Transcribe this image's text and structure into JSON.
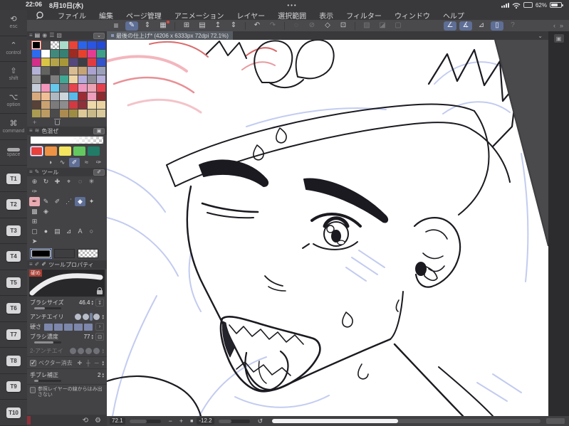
{
  "status": {
    "time": "22:06",
    "date": "8月10日(水)",
    "center": "•••",
    "battery_percent": "62%"
  },
  "edge_keyboard": {
    "keys": [
      {
        "id": "esc",
        "glyph": "⟲",
        "label": "esc"
      },
      {
        "id": "control",
        "glyph": "⌃",
        "label": "control"
      },
      {
        "id": "shift",
        "glyph": "⇧",
        "label": "shift"
      },
      {
        "id": "option",
        "glyph": "⌥",
        "label": "option"
      },
      {
        "id": "command",
        "glyph": "⌘",
        "label": "command"
      },
      {
        "id": "space",
        "glyph": "",
        "label": "space"
      },
      {
        "id": "t1",
        "type": "t",
        "label": "T1"
      },
      {
        "id": "t2",
        "type": "t",
        "label": "T2"
      },
      {
        "id": "t3",
        "type": "t",
        "label": "T3"
      },
      {
        "id": "t4",
        "type": "t",
        "label": "T4"
      },
      {
        "id": "t5",
        "type": "t",
        "label": "T5"
      },
      {
        "id": "t6",
        "type": "t",
        "label": "T6"
      },
      {
        "id": "t7",
        "type": "t",
        "label": "T7"
      },
      {
        "id": "t8",
        "type": "t",
        "label": "T8"
      },
      {
        "id": "t9",
        "type": "t",
        "label": "T9"
      },
      {
        "id": "t10",
        "type": "t",
        "label": "T10"
      }
    ]
  },
  "menubar": {
    "items": [
      "ファイル",
      "編集",
      "ページ管理",
      "アニメーション",
      "レイヤー",
      "選択範囲",
      "表示",
      "フィルター",
      "ウィンドウ",
      "ヘルプ"
    ]
  },
  "toolbar": {
    "hamburger": "≡",
    "buttons": [
      {
        "name": "edit-mode",
        "glyph": "✎",
        "state": "active"
      },
      {
        "name": "mode-expand",
        "glyph": "⇕"
      },
      {
        "name": "gallery",
        "glyph": "▦",
        "badge": true
      },
      {
        "divider": true
      },
      {
        "name": "new-canvas",
        "glyph": "⊞"
      },
      {
        "name": "open-file",
        "glyph": "▤"
      },
      {
        "name": "export",
        "glyph": "↥"
      },
      {
        "name": "export-expand",
        "glyph": "⇕"
      },
      {
        "divider": true
      },
      {
        "name": "undo",
        "glyph": "↶"
      },
      {
        "name": "redo",
        "glyph": "↷",
        "state": "dim"
      },
      {
        "divider": true
      },
      {
        "name": "select-area",
        "glyph": "◌",
        "state": "dim"
      },
      {
        "name": "deselect",
        "glyph": "⊘",
        "state": "dim"
      },
      {
        "name": "fill",
        "glyph": "◇"
      },
      {
        "name": "transform",
        "glyph": "⊡"
      },
      {
        "divider": true
      },
      {
        "name": "mask",
        "glyph": "▧",
        "state": "dim"
      },
      {
        "name": "layer-gradient",
        "glyph": "◪",
        "state": "dim"
      },
      {
        "name": "frame",
        "glyph": "▢",
        "state": "dim"
      }
    ],
    "right_buttons": [
      {
        "name": "snap-ruler",
        "glyph": "∠",
        "state": "active"
      },
      {
        "name": "snap-curve",
        "glyph": "∡",
        "state": "active"
      },
      {
        "name": "snap-grid",
        "glyph": "⊿"
      },
      {
        "name": "companion-mode",
        "glyph": "▯",
        "state": "active"
      },
      {
        "name": "help",
        "glyph": "?",
        "state": "dim"
      }
    ],
    "collapse_glyphs": [
      "‹",
      "»"
    ]
  },
  "canvas": {
    "tab_title": "最後の仕上げ* (4206 x 6333px 72dpi 72.1%)"
  },
  "panels": {
    "color": {
      "header_icons": [
        {
          "name": "panel-menu",
          "glyph": "≡"
        },
        {
          "name": "color-set-tab",
          "glyph": "▤",
          "active": true
        },
        {
          "name": "color-wheel-tab",
          "glyph": "◉"
        },
        {
          "name": "color-slider-tab",
          "glyph": "☰"
        },
        {
          "name": "approx-color-tab",
          "glyph": "▧"
        }
      ],
      "collapse_glyph": "⌄",
      "add_glyph": "+",
      "selected_index": 0,
      "swatches": [
        "#000000",
        "#4a4a4a",
        "checker",
        "#aadcca",
        "#e84338",
        "#2b63ea",
        "#2a55e2",
        "#2349d8",
        "#2c6bf0",
        "#ffffff",
        "#418a7b",
        "#368174",
        "#9e2a21",
        "#e8402b",
        "#e73b92",
        "#3da189",
        "#d22e8a",
        "#d9c445",
        "#b3a44a",
        "#a89838",
        "#55477c",
        "#3d3d45",
        "#e13b41",
        "#3153cd",
        "#b4b1d7",
        "#636360",
        "#404040",
        "#595959",
        "#dabc93",
        "#c7a475",
        "#aaa3d0",
        "#9ba1b9",
        "#9d9d9d",
        "#3b3b3b",
        "#7f7f7f",
        "#40a794",
        "#edd5a5",
        "#b3abdc",
        "#8c8c94",
        "#b5afd9",
        "#c6cdd9",
        "#f396bc",
        "#65c9ed",
        "#71757d",
        "#e9444e",
        "#ef95bd",
        "#eba3b3",
        "#e5414d",
        "#d7aa7d",
        "#efbe95",
        "#afb7c1",
        "#cdd5db",
        "#59bae9",
        "#9d2b35",
        "#ef9dbd",
        "#8d2931",
        "#574139",
        "#caa271",
        "#7b7b7b",
        "#8d8d8d",
        "#d33941",
        "#8f3139",
        "#edd9a9",
        "#ead3a1",
        "#a99b51",
        "#bc9b63",
        "#4b4b4b",
        "#ac8b51",
        "#9d8d43",
        "#ddc997",
        "#c9b989",
        "#d9c99b"
      ]
    },
    "mix": {
      "title": "色混ぜ",
      "header_icon": "≋",
      "chips": [
        "#e8403c",
        "#ee9243",
        "#f4e45e",
        "#63c85f",
        "#207b67"
      ],
      "selected_chip": 0,
      "tools": [
        {
          "name": "blend-tool",
          "glyph": "◑"
        },
        {
          "name": "smudge-tool",
          "glyph": "∿"
        },
        {
          "name": "mix-brush-tool",
          "glyph": "✐",
          "active": true
        },
        {
          "name": "watercolor-tool",
          "glyph": "≈"
        },
        {
          "name": "pick-tool",
          "glyph": "✑"
        }
      ]
    },
    "tool": {
      "title": "ツール",
      "rows": [
        [
          {
            "name": "zoom-tool",
            "glyph": "⊕"
          },
          {
            "name": "rotate-tool",
            "glyph": "↻"
          },
          {
            "name": "move-tool",
            "glyph": "✚"
          },
          {
            "name": "operate-tool",
            "glyph": "⌖"
          },
          {
            "name": "lasso-tool",
            "glyph": "◌"
          },
          {
            "name": "wand-tool",
            "glyph": "✳"
          }
        ],
        [
          {
            "name": "eyedropper-tool",
            "glyph": "✑"
          }
        ],
        [
          {
            "name": "pen-tool",
            "glyph": "✒",
            "accent": true
          },
          {
            "name": "pencil-tool",
            "glyph": "✎"
          },
          {
            "name": "brush-tool",
            "glyph": "✐"
          },
          {
            "name": "airbrush-tool",
            "glyph": "⋰"
          },
          {
            "name": "eraser-tool",
            "glyph": "◆",
            "active": true
          },
          {
            "name": "decoration-tool",
            "glyph": "✦"
          }
        ],
        [
          {
            "name": "gradient-tool",
            "glyph": "▩"
          },
          {
            "name": "fill-tool",
            "glyph": "◈"
          }
        ],
        [
          {
            "name": "frame-border-tool",
            "glyph": "⊞"
          }
        ],
        [
          {
            "name": "selection-tool",
            "glyph": "▢"
          },
          {
            "name": "figure-tool",
            "glyph": "●"
          },
          {
            "name": "panel-tool",
            "glyph": "▤"
          },
          {
            "name": "ruler-tool",
            "glyph": "⊿"
          },
          {
            "name": "text-tool",
            "glyph": "A"
          },
          {
            "name": "balloon-tool",
            "glyph": "○"
          }
        ],
        [
          {
            "name": "object-select-tool",
            "glyph": "➤"
          }
        ]
      ],
      "main_color": "#000000",
      "sub_color": "#3e3e40"
    },
    "tool_property": {
      "title": "ツールプロパティ",
      "tab_icons": [
        {
          "name": "subtool-tab",
          "glyph": "✐"
        },
        {
          "name": "property-tab",
          "glyph": "✐",
          "active": true
        }
      ],
      "brush_name": "硬め",
      "brush_size": {
        "label": "ブラシサイズ",
        "value": "46.4"
      },
      "anti_alias": {
        "label": "アンチエイリ"
      },
      "hardness": {
        "label": "硬さ",
        "more": "›"
      },
      "density": {
        "label": "ブラシ濃度",
        "value": "77"
      },
      "anti_alias2": {
        "label": "2-アンチエイ"
      },
      "vector_erase": {
        "label": "ベクター消去",
        "mode_glyphs": [
          "✚",
          "┼",
          "─"
        ]
      },
      "stabilize": {
        "label": "手ブレ補正",
        "value": "2"
      },
      "ref_checkbox_label": "参照レイヤーの線からはみ出さない",
      "footer_icons": [
        {
          "name": "reset-settings",
          "glyph": "⟲"
        },
        {
          "name": "subtool-detail",
          "glyph": "⚙"
        }
      ]
    }
  },
  "right_strip": {
    "icon_glyph": "▣"
  },
  "bottom_bar": {
    "zoom_value": "72.1",
    "minus": "−",
    "plus": "+",
    "fit": "■",
    "rotate_value": "-12.2",
    "reset_rotation": "↺"
  }
}
